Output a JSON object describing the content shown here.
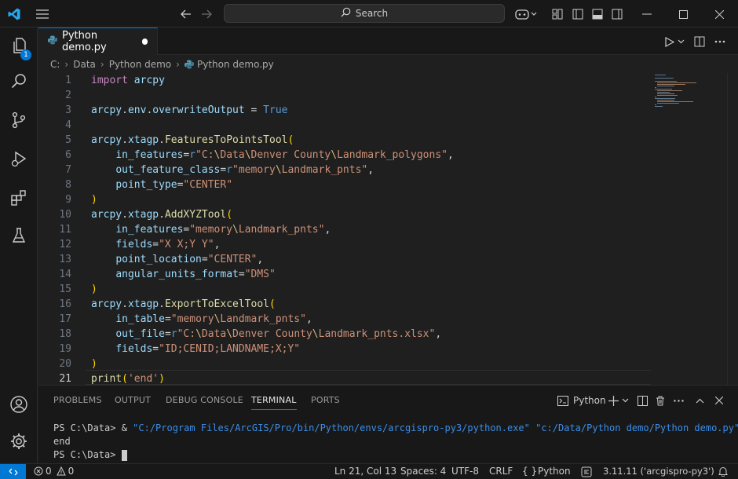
{
  "titlebar": {
    "search_label": "Search"
  },
  "activity_bar": {
    "explorer_badge": "1"
  },
  "tab": {
    "label": "Python demo.py"
  },
  "breadcrumb": [
    "C:",
    "Data",
    "Python demo",
    "Python demo.py"
  ],
  "editor": {
    "line_numbers": [
      "1",
      "2",
      "3",
      "4",
      "5",
      "6",
      "7",
      "8",
      "9",
      "10",
      "11",
      "12",
      "13",
      "14",
      "15",
      "16",
      "17",
      "18",
      "19",
      "20",
      "21"
    ]
  },
  "panel": {
    "tabs": [
      "PROBLEMS",
      "OUTPUT",
      "DEBUG CONSOLE",
      "TERMINAL",
      "PORTS"
    ],
    "active_tab": "TERMINAL",
    "terminal_profile": "Python",
    "terminal": {
      "prompt": "PS C:\\Data> ",
      "amp": "& ",
      "command_args": "\"C:/Program Files/ArcGIS/Pro/bin/Python/envs/arcgispro-py3/python.exe\" \"c:/Data/Python demo/Python demo.py\"",
      "output": "end",
      "prompt2": "PS C:\\Data> "
    }
  },
  "statusbar": {
    "errors": "0",
    "warnings": "0",
    "position": "Ln 21, Col 13",
    "spaces": "Spaces: 4",
    "encoding": "UTF-8",
    "eol": "CRLF",
    "braces": "{ }",
    "language": "Python",
    "interpreter": "3.11.11 ('arcgispro-py3')"
  },
  "colors": {
    "accent": "#0078d4",
    "background": "#1f1f1f",
    "chrome": "#181818"
  }
}
